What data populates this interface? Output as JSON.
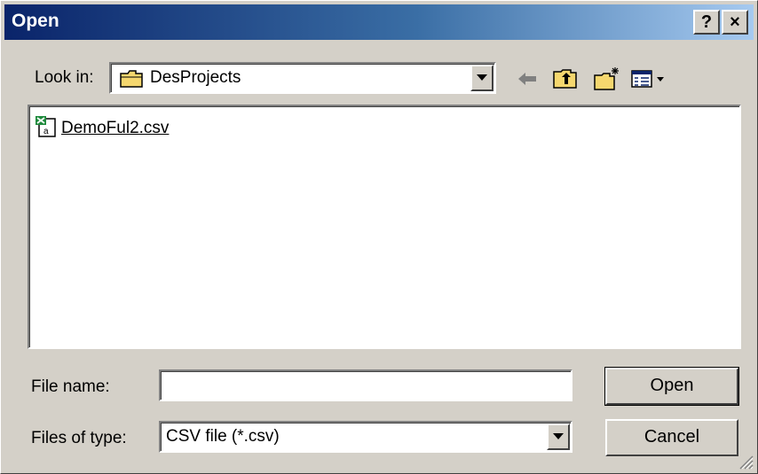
{
  "window": {
    "title": "Open",
    "help_label": "?",
    "close_label": "×"
  },
  "look_in": {
    "label": "Look in:",
    "value": "DesProjects",
    "folder_icon": "folder-icon"
  },
  "toolbar": {
    "back_icon": "back-arrow-icon",
    "up_icon": "up-folder-icon",
    "new_folder_icon": "new-folder-icon",
    "view_icon": "view-menu-icon"
  },
  "files": [
    {
      "name": "DemoFul2.csv",
      "icon": "csv-file-icon"
    }
  ],
  "file_name": {
    "label": "File name:",
    "value": ""
  },
  "file_type": {
    "label": "Files of type:",
    "value": "CSV file (*.csv)"
  },
  "buttons": {
    "open": "Open",
    "cancel": "Cancel"
  },
  "colors": {
    "title_start": "#0a246a",
    "title_end": "#a6caf0",
    "face": "#d4d0c8"
  }
}
